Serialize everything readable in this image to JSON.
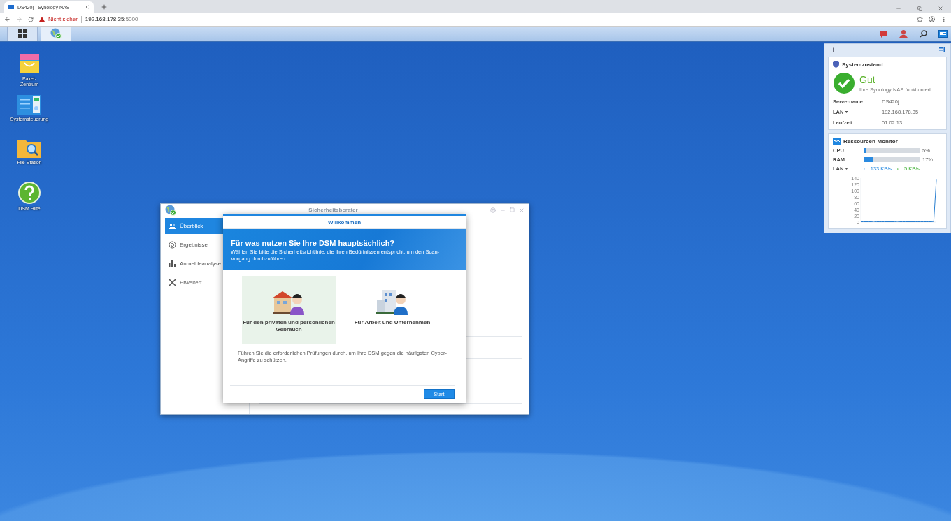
{
  "browser": {
    "tab_title": "DS420j - Synology NAS",
    "warning": "Nicht sicher",
    "host": "192.168.178.35",
    "port": ":5000"
  },
  "taskbar": {
    "apps": [
      {
        "kind": "main-menu",
        "selected": false
      },
      {
        "kind": "security-advisor",
        "selected": true
      }
    ]
  },
  "desktop_icons": [
    {
      "kind": "package",
      "label": "Paket-\nZentrum"
    },
    {
      "kind": "control",
      "label": "Systemsteuerung"
    },
    {
      "kind": "folder",
      "label": "File Station"
    },
    {
      "kind": "help",
      "label": "DSM Hilfe"
    }
  ],
  "system_health": {
    "title": "Systemzustand",
    "status": "Gut",
    "message": "Ihre Synology NAS funktioniert ...",
    "rows": [
      {
        "label": "Servername",
        "value": "DS420j",
        "dropdown": false
      },
      {
        "label": "LAN",
        "value": "192.168.178.35",
        "dropdown": true
      },
      {
        "label": "Laufzeit",
        "value": "01:02:13",
        "dropdown": false
      }
    ]
  },
  "resource_monitor": {
    "title": "Ressourcen-Monitor",
    "meters": [
      {
        "label": "CPU",
        "level": 0.05,
        "reading": "5%"
      },
      {
        "label": "RAM",
        "level": 0.17,
        "reading": "17%"
      }
    ],
    "lan": {
      "label": "LAN",
      "upload": "133 KB/s",
      "download": "5 KB/s"
    },
    "chart_data": {
      "type": "line",
      "ylim": [
        0,
        140
      ],
      "yticks": [
        0,
        20,
        40,
        60,
        80,
        100,
        120,
        140
      ],
      "series": [
        {
          "color": "#2a7fd0",
          "values": [
            1,
            1,
            1,
            1,
            1,
            2,
            1,
            1,
            1,
            1,
            1,
            1,
            1,
            1,
            2,
            1,
            1,
            1,
            1,
            1,
            1,
            1,
            1,
            1,
            1,
            1,
            1,
            1,
            2,
            135
          ]
        }
      ]
    }
  },
  "window": {
    "title": "Sicherheitsberater",
    "sidebar": [
      {
        "kind": "overview",
        "label": "Überblick",
        "selected": true
      },
      {
        "kind": "results",
        "label": "Ergebnisse",
        "selected": false
      },
      {
        "kind": "login",
        "label": "Anmeldeanalyse",
        "selected": false
      },
      {
        "kind": "advanced",
        "label": "Erweitert",
        "selected": false
      }
    ]
  },
  "dialog": {
    "title": "Willkommen",
    "heading": "Für was nutzen Sie Ihre DSM hauptsächlich?",
    "text": "Wählen Sie bitte die Sicherheitsrichtlinie, die Ihren Bedürfnissen entspricht, um den Scan-Vorgang durchzuführen.",
    "options": [
      {
        "kind": "home",
        "label": "Für den privaten und persönlichen Gebrauch",
        "selected": true
      },
      {
        "kind": "business",
        "label": "Für Arbeit und Unternehmen",
        "selected": false
      }
    ],
    "description": "Führen Sie die erforderlichen Prüfungen durch, um Ihre DSM gegen die häufigsten Cyber-Angriffe zu schützen.",
    "button": "Start"
  }
}
